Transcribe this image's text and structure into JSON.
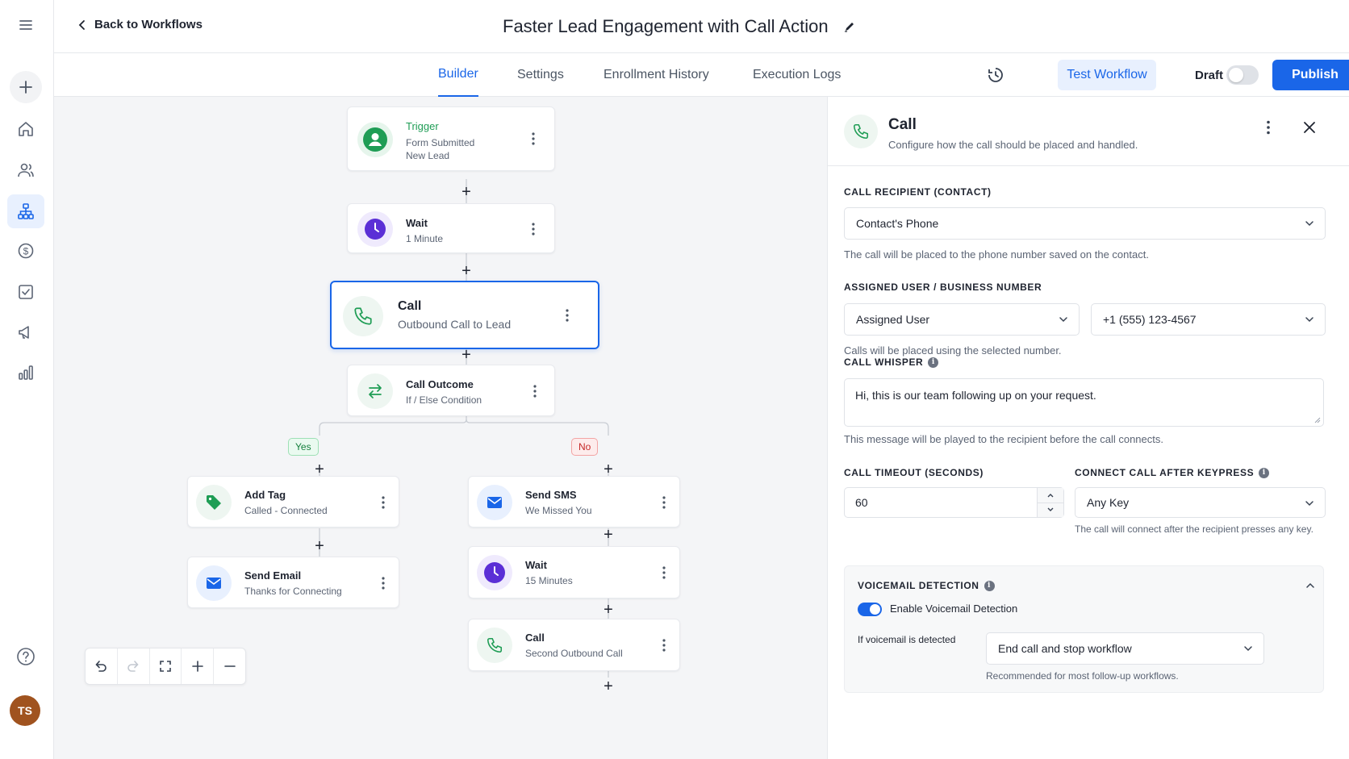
{
  "rail": {
    "avatar_initials": "TS",
    "items": [
      "home-icon",
      "contacts-icon",
      "workflows-icon",
      "billing-icon",
      "tasks-icon",
      "marketing-icon",
      "reports-icon"
    ]
  },
  "header": {
    "back_label": "Back to Workflows",
    "title": "Faster Lead Engagement with Call Action"
  },
  "tabs": {
    "builder": "Builder",
    "settings": "Settings",
    "enrollment": "Enrollment History",
    "logs": "Execution Logs",
    "active": "Builder"
  },
  "toolbar": {
    "test_label": "Test Workflow",
    "draft_label": "Draft",
    "draft_enabled": false,
    "publish_label": "Publish"
  },
  "canvas": {
    "trigger": {
      "title": "Trigger",
      "line1": "Form Submitted",
      "line2": "New Lead"
    },
    "wait1": {
      "title": "Wait",
      "sub": "1 Minute"
    },
    "call": {
      "title": "Call",
      "sub": "Outbound Call to Lead"
    },
    "outcome": {
      "title": "Call Outcome",
      "sub": "If / Else Condition"
    },
    "yes_label": "Yes",
    "no_label": "No",
    "add_tag": {
      "title": "Add Tag",
      "sub": "Called - Connected"
    },
    "send_email": {
      "title": "Send Email",
      "sub": "Thanks for Connecting"
    },
    "send_sms": {
      "title": "Send SMS",
      "sub": "We Missed You"
    },
    "wait2": {
      "title": "Wait",
      "sub": "15 Minutes"
    },
    "call2": {
      "title": "Call",
      "sub": "Second Outbound Call"
    }
  },
  "panel": {
    "title": "Call",
    "subtitle": "Configure how the call should be placed and handled.",
    "recipient": {
      "label": "CALL RECIPIENT (CONTACT)",
      "value": "Contact's Phone",
      "help": "The call will be placed to the phone number saved on the contact."
    },
    "assigned": {
      "label": "ASSIGNED USER / BUSINESS NUMBER",
      "user_value": "Assigned User",
      "number_value": "+1 (555) 123-4567",
      "help": "Calls will be placed using the selected number."
    },
    "whisper": {
      "label": "CALL WHISPER",
      "value": "Hi, this is our team following up on your request.",
      "help": "This message will be played to the recipient before the call connects."
    },
    "timeout": {
      "label": "CALL TIMEOUT (SECONDS)",
      "value": "60"
    },
    "keypress": {
      "label": "CONNECT CALL AFTER KEYPRESS",
      "value": "Any Key",
      "help": "The call will connect after the recipient presses any key."
    },
    "voicemail": {
      "label": "VOICEMAIL DETECTION",
      "toggle_label": "Enable Voicemail Detection",
      "enabled": true,
      "if_label": "If voicemail is detected",
      "action_value": "End call and stop workflow",
      "help": "Recommended for most follow-up workflows."
    }
  },
  "colors": {
    "accent": "#1a66e8",
    "green": "#1f9d55",
    "purple": "#5b2fd6"
  }
}
